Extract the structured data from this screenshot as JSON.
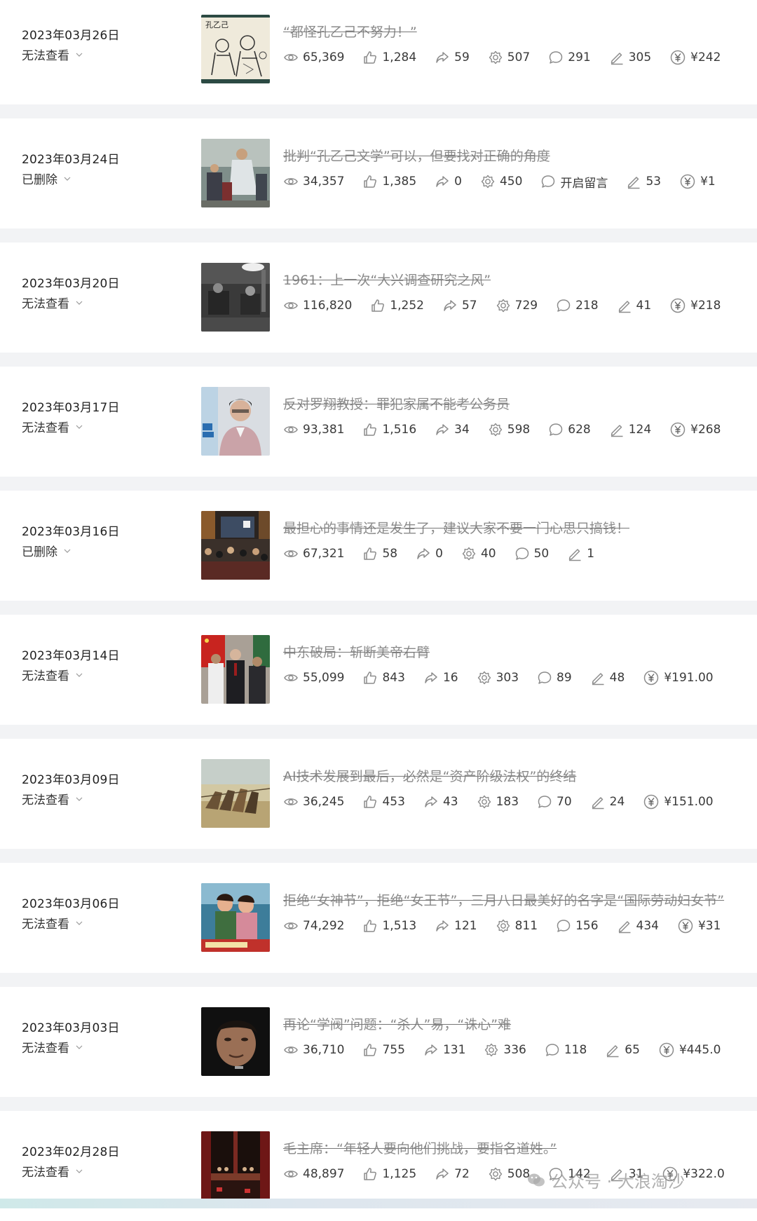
{
  "articles": [
    {
      "date": "2023年03月26日",
      "status": "无法查看",
      "title": "“都怪孔乙己不努力！”",
      "stats": {
        "views": "65,369",
        "likes": "1,284",
        "shares": "59",
        "wows": "507",
        "comments": "291",
        "notes": "305",
        "reward": "¥242"
      },
      "thumb": "sketch-kong"
    },
    {
      "date": "2023年03月24日",
      "status": "已删除",
      "title": "批判“孔乙己文学”可以，但要找对正确的角度",
      "stats": {
        "views": "34,357",
        "likes": "1,385",
        "shares": "0",
        "wows": "450",
        "comments": "开启留言",
        "notes": "53",
        "reward": "¥1"
      },
      "thumb": "painting"
    },
    {
      "date": "2023年03月20日",
      "status": "无法查看",
      "title": "1961：上一次“大兴调查研究之风”",
      "stats": {
        "views": "116,820",
        "likes": "1,252",
        "shares": "57",
        "wows": "729",
        "comments": "218",
        "notes": "41",
        "reward": "¥218"
      },
      "thumb": "bw-photo"
    },
    {
      "date": "2023年03月17日",
      "status": "无法查看",
      "title": "反对罗翔教授：罪犯家属不能考公务员",
      "stats": {
        "views": "93,381",
        "likes": "1,516",
        "shares": "34",
        "wows": "598",
        "comments": "628",
        "notes": "124",
        "reward": "¥268"
      },
      "thumb": "speaker"
    },
    {
      "date": "2023年03月16日",
      "status": "已删除",
      "title": "最担心的事情还是发生了，建议大家不要一门心思只搞钱！",
      "stats": {
        "views": "67,321",
        "likes": "58",
        "shares": "0",
        "wows": "40",
        "comments": "50",
        "notes": "1",
        "reward": ""
      },
      "thumb": "crowd"
    },
    {
      "date": "2023年03月14日",
      "status": "无法查看",
      "title": "中东破局：斩断美帝右臂",
      "stats": {
        "views": "55,099",
        "likes": "843",
        "shares": "16",
        "wows": "303",
        "comments": "89",
        "notes": "48",
        "reward": "¥191.00"
      },
      "thumb": "officials"
    },
    {
      "date": "2023年03月09日",
      "status": "无法查看",
      "title": "AI技术发展到最后，必然是“资产阶级法权”的终结",
      "stats": {
        "views": "36,245",
        "likes": "453",
        "shares": "43",
        "wows": "183",
        "comments": "70",
        "notes": "24",
        "reward": "¥151.00"
      },
      "thumb": "haulers"
    },
    {
      "date": "2023年03月06日",
      "status": "无法查看",
      "title": "拒绝“女神节”，拒绝“女王节”，三月八日最美好的名字是“国际劳动妇女节”",
      "stats": {
        "views": "74,292",
        "likes": "1,513",
        "shares": "121",
        "wows": "811",
        "comments": "156",
        "notes": "434",
        "reward": "¥31"
      },
      "thumb": "poster"
    },
    {
      "date": "2023年03月03日",
      "status": "无法查看",
      "title": "再论“学阀”问题：“杀人”易，“诛心”难",
      "stats": {
        "views": "36,710",
        "likes": "755",
        "shares": "131",
        "wows": "336",
        "comments": "118",
        "notes": "65",
        "reward": "¥445.0"
      },
      "thumb": "face"
    },
    {
      "date": "2023年02月28日",
      "status": "无法查看",
      "title": "毛主席：“年轻人要向他们挑战，要指名道姓。”",
      "stats": {
        "views": "48,897",
        "likes": "1,125",
        "shares": "72",
        "wows": "508",
        "comments": "142",
        "notes": "31",
        "reward": "¥322.0"
      },
      "thumb": "stage"
    }
  ],
  "watermark": "公众号 · 大浪淘沙",
  "colors": {
    "background": "#f2f3f5",
    "row": "#ffffff",
    "title_struck": "#8a8a8a",
    "icon": "#8c8c8c"
  }
}
